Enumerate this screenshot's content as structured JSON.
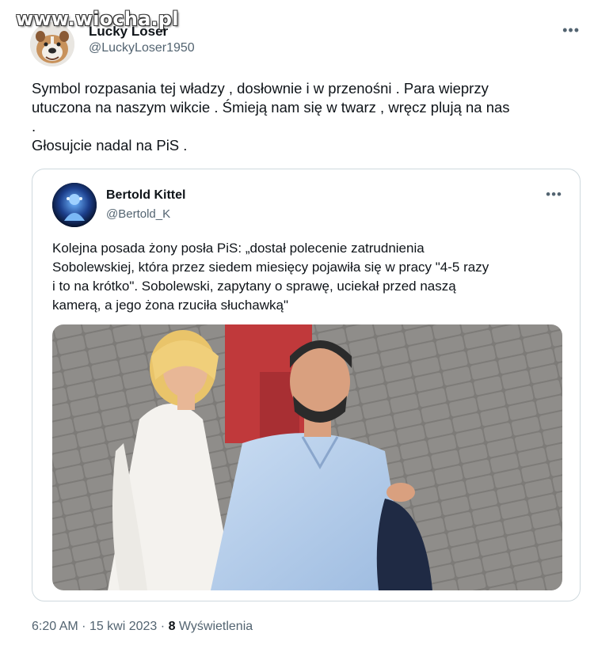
{
  "watermark": "www.wiocha.pl",
  "author": {
    "name": "Lucky Loser",
    "handle": "@LuckyLoser1950",
    "avatar_icon": "bulldog-avatar"
  },
  "more_icon": "•••",
  "tweet": {
    "line1": "Symbol rozpasania tej władzy , dosłownie i w przenośni . Para wieprzy",
    "line2": "utuczona na naszym wikcie . Śmieją nam się w twarz , wręcz plują na nas",
    "line3": ".",
    "line4": "Głosujcie nadal na PiS ."
  },
  "quote": {
    "author_name": "Bertold Kittel",
    "author_handle": "@Bertold_K",
    "avatar_icon": "blue-figure-avatar",
    "line1": "Kolejna posada żony posła PiS: „dostał polecenie zatrudnienia",
    "line2": "Sobolewskiej, która przez siedem miesięcy pojawiła się w pracy \"4-5 razy",
    "line3": "i to na krótko\". Sobolewski, zapytany o sprawę, uciekał przed naszą",
    "line4": "kamerą, a jego żona rzuciła słuchawką\"",
    "photo": "man-and-woman-on-paved-square"
  },
  "meta": {
    "time": "6:20 AM",
    "separator": "·",
    "date": "15 kwi 2023",
    "views_count": "8",
    "views_label": "Wyświetlenia"
  },
  "colors": {
    "text": "#0f1419",
    "secondary": "#536471",
    "border": "#cfd9de"
  }
}
